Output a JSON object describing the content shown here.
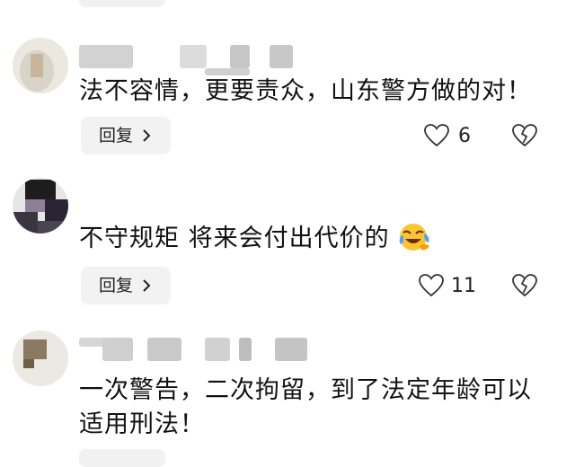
{
  "comments": [
    {
      "text": "法不容情，更要责众，山东警方做的对！",
      "reply_label": "回复",
      "like_count": "6"
    },
    {
      "text": "不守规矩 将来会付出代价的",
      "emoji": "laughing-crying-emoji",
      "reply_label": "回复",
      "like_count": "11"
    },
    {
      "text": "一次警告，二次拘留，到了法定年龄可以适用刑法！"
    }
  ],
  "icons": {
    "like": "heart-outline-icon",
    "dislike": "broken-heart-icon",
    "reply_arrow": "chevron-right-icon"
  }
}
